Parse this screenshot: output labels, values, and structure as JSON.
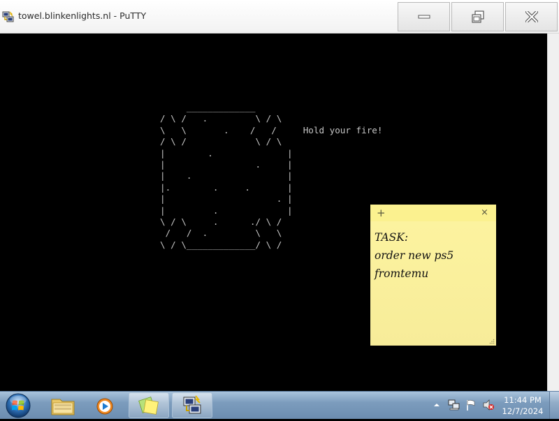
{
  "window": {
    "title": "towel.blinkenlights.nl - PuTTY",
    "icons": [
      "putty-icon",
      "minimize-icon",
      "maximize-icon",
      "close-icon"
    ]
  },
  "terminal": {
    "lines": [
      "     _____________",
      "/ \\ /   .         \\ / \\",
      "\\   \\       .    /   /     Hold your fire!",
      "/ \\ /             \\ / \\",
      "|        .              |",
      "|                 .     |",
      "|    .                  |",
      "|.        .     .       |",
      "|                     . |",
      "|         .             |",
      "\\ / \\     .      ./ \\ /",
      " /   /  .         \\   \\",
      "\\ / \\_____________/ \\ /"
    ],
    "color": "#c6c6c6",
    "background": "#000000"
  },
  "sticky_note": {
    "add_label": "+",
    "close_label": "×",
    "lines": [
      "TASK:",
      "order new ps5",
      "fromtemu"
    ],
    "color": "#fdf4a0"
  },
  "taskbar": {
    "items": [
      "start-orb-icon",
      "windows-explorer-icon",
      "media-player-icon",
      "sticky-notes-icon",
      "putty-icon"
    ],
    "tray_icons": [
      "show-hidden-icons-icon",
      "network-icon",
      "action-center-flag-icon",
      "volume-muted-icon"
    ],
    "time": "11:44 PM",
    "date": "12/7/2024"
  }
}
